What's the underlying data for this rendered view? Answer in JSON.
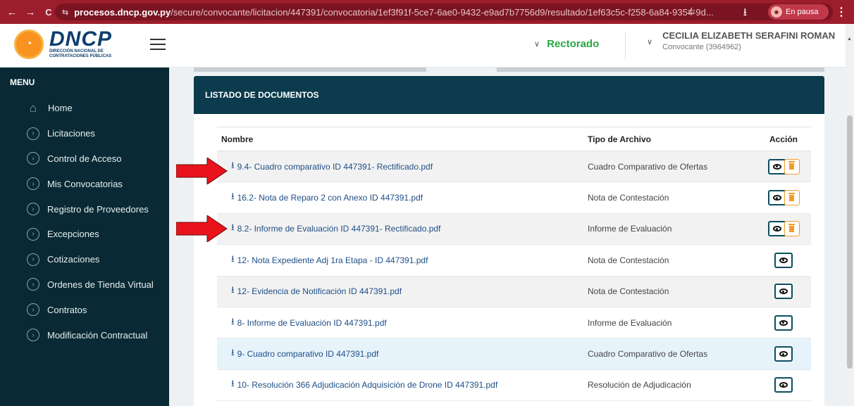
{
  "browser": {
    "back": "←",
    "forward": "→",
    "reload": "C",
    "site_info": "⇆",
    "url_host": "procesos.dncp.gov.py",
    "url_path": "/secure/convocante/licitacion/447391/convocatoria/1ef3f91f-5ce7-6ae0-9432-e9ad7b7756d9/resultado/1ef63c5c-f258-6a84-9354-9d...",
    "star": "☆",
    "download": "⭳",
    "profile_status": "En pausa",
    "menu": "⋮"
  },
  "header": {
    "logo_title": "DNCP",
    "logo_sub_1": "DIRECCIÓN NACIONAL DE",
    "logo_sub_2": "CONTRATACIONES PÚBLICAS",
    "org": "Rectorado",
    "user_name": "CECILIA ELIZABETH SERAFINI ROMAN",
    "user_role": "Convocante (3964962)"
  },
  "sidebar": {
    "heading": "MENU",
    "items": [
      {
        "label": "Home",
        "icon": "home-icon"
      },
      {
        "label": "Licitaciones",
        "icon": "chevron-circle-icon"
      },
      {
        "label": "Control de Acceso",
        "icon": "chevron-circle-icon"
      },
      {
        "label": "Mis Convocatorias",
        "icon": "chevron-circle-icon"
      },
      {
        "label": "Registro de Proveedores",
        "icon": "chevron-circle-icon"
      },
      {
        "label": "Excepciones",
        "icon": "chevron-circle-icon"
      },
      {
        "label": "Cotizaciones",
        "icon": "chevron-circle-icon"
      },
      {
        "label": "Ordenes de Tienda Virtual",
        "icon": "chevron-circle-icon"
      },
      {
        "label": "Contratos",
        "icon": "chevron-circle-icon"
      },
      {
        "label": "Modificación Contractual",
        "icon": "chevron-circle-icon"
      }
    ]
  },
  "documents": {
    "title": "LISTADO DE DOCUMENTOS",
    "columns": {
      "name": "Nombre",
      "type": "Tipo de Archivo",
      "action": "Acción"
    },
    "rows": [
      {
        "name": "9.4- Cuadro comparativo ID 447391- Rectificado.pdf",
        "type": "Cuadro Comparativo de Ofertas",
        "deletable": true
      },
      {
        "name": "16.2- Nota de Reparo 2 con Anexo ID 447391.pdf",
        "type": "Nota de Contestación",
        "deletable": true
      },
      {
        "name": "8.2- Informe de Evaluación ID 447391- Rectificado.pdf",
        "type": "Informe de Evaluación",
        "deletable": true
      },
      {
        "name": "12- Nota Expediente Adj 1ra Etapa - ID 447391.pdf",
        "type": "Nota de Contestación",
        "deletable": false
      },
      {
        "name": "12- Evidencia de Notificación ID 447391.pdf",
        "type": "Nota de Contestación",
        "deletable": false
      },
      {
        "name": "8- Informe de Evaluación ID 447391.pdf",
        "type": "Informe de Evaluación",
        "deletable": false
      },
      {
        "name": "9- Cuadro comparativo ID 447391.pdf",
        "type": "Cuadro Comparativo de Ofertas",
        "deletable": false
      },
      {
        "name": "10- Resolución 366 Adjudicación Adquisición de Drone ID 447391.pdf",
        "type": "Resolución de Adjudicación",
        "deletable": false
      }
    ]
  },
  "colors": {
    "browser_bar": "#9c1d2c",
    "sidebar": "#092a35",
    "card_header": "#0b3b4c",
    "org_green": "#28a745",
    "link": "#1e4f86",
    "delete_orange": "#f39c2c",
    "arrow_red": "#e8131b"
  }
}
